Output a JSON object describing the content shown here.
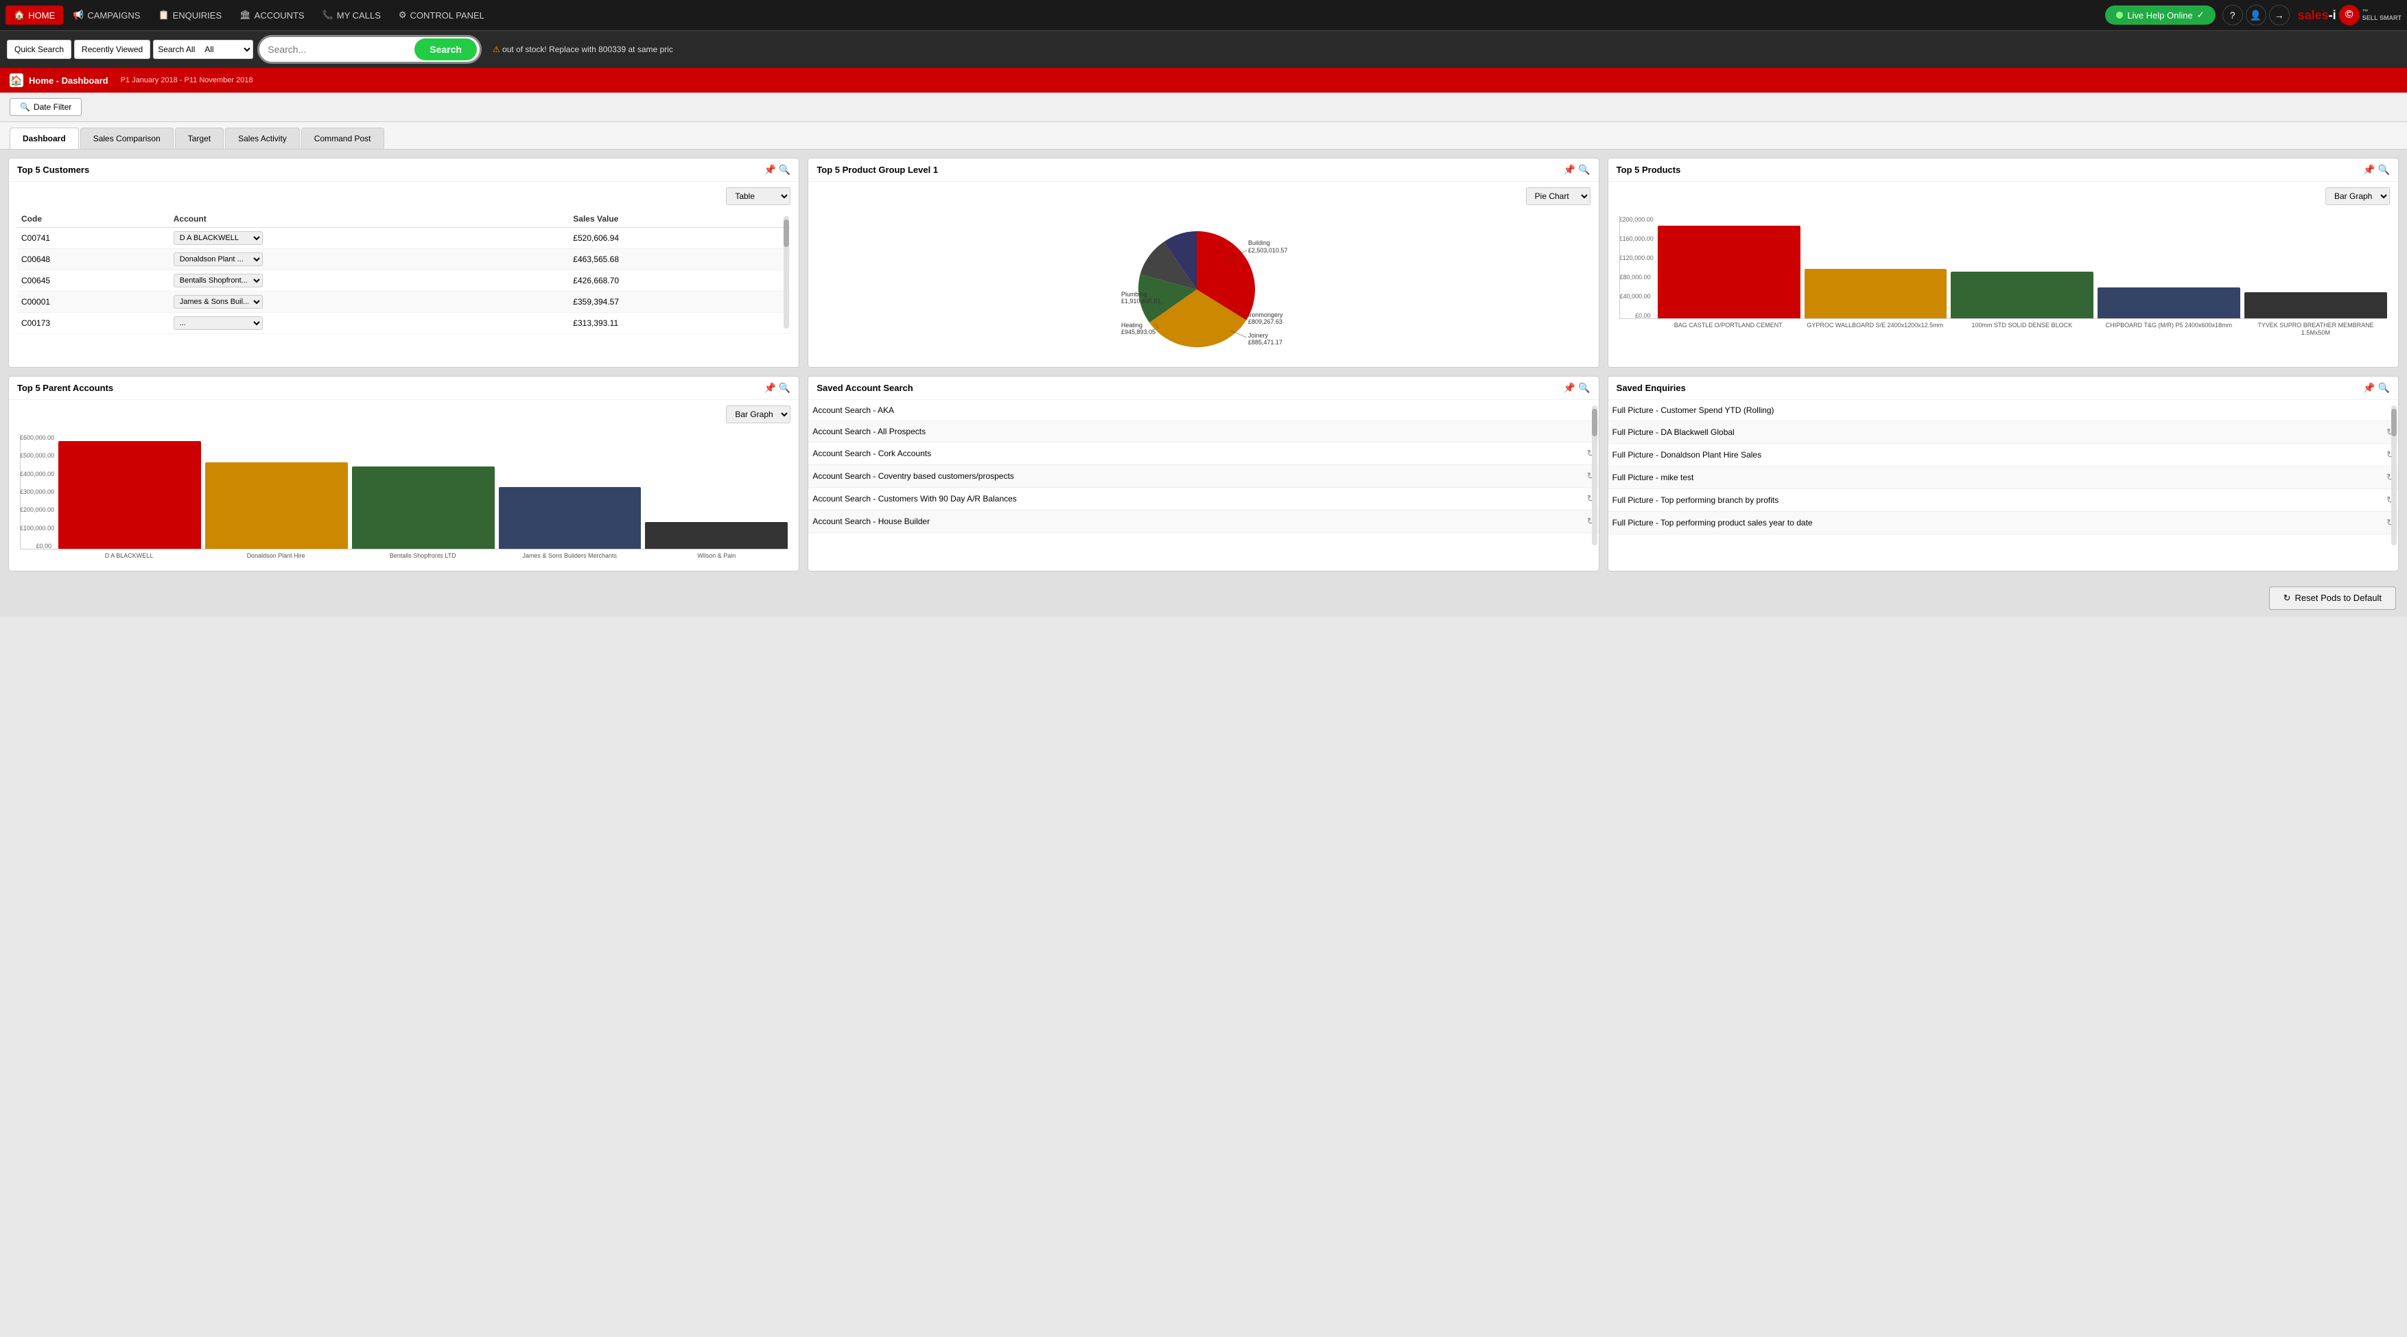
{
  "nav": {
    "items": [
      {
        "label": "HOME",
        "icon": "🏠",
        "active": true
      },
      {
        "label": "CAMPAIGNS",
        "icon": "📢",
        "active": false
      },
      {
        "label": "ENQUIRIES",
        "icon": "📋",
        "active": false
      },
      {
        "label": "ACCOUNTS",
        "icon": "🏛",
        "active": false
      },
      {
        "label": "MY CALLS",
        "icon": "📞",
        "active": false
      },
      {
        "label": "CONTROL PANEL",
        "icon": "⚙",
        "active": false
      }
    ],
    "live_help": "Live Help Online",
    "logo_main": "sales-i",
    "logo_sub": "SELL SMART"
  },
  "search_bar": {
    "quick_search": "Quick Search",
    "recently_viewed": "Recently Viewed",
    "search_all": "Search All",
    "search_all_option": "All",
    "placeholder": "Search...",
    "search_btn": "Search",
    "ticker_text": "out of stock! Replace with 800339 at same pric"
  },
  "breadcrumb": {
    "title": "Home - Dashboard",
    "date_range": "P1 January 2018 - P11 November 2018"
  },
  "filter": {
    "date_filter": "Date Filter"
  },
  "tabs": [
    {
      "label": "Dashboard",
      "active": true
    },
    {
      "label": "Sales Comparison",
      "active": false
    },
    {
      "label": "Target",
      "active": false
    },
    {
      "label": "Sales Activity",
      "active": false
    },
    {
      "label": "Command Post",
      "active": false
    }
  ],
  "pods": {
    "top5_customers": {
      "title": "Top 5 Customers",
      "view_options": [
        "Table",
        "Bar Graph",
        "Pie Chart"
      ],
      "selected_view": "Table",
      "columns": [
        "Code",
        "Account",
        "Sales Value"
      ],
      "rows": [
        {
          "code": "C00741",
          "account": "D A BLACKWELL",
          "value": "£520,606.94"
        },
        {
          "code": "C00648",
          "account": "Donaldson Plant ...",
          "value": "£463,565.68"
        },
        {
          "code": "C00645",
          "account": "Bentalls Shopfront...",
          "value": "£426,668.70"
        },
        {
          "code": "C00001",
          "account": "James & Sons Buil...",
          "value": "£359,394.57"
        },
        {
          "code": "C00173",
          "account": "...",
          "value": "£313,393.11"
        }
      ]
    },
    "top5_product_group": {
      "title": "Top 5 Product Group Level 1",
      "view_options": [
        "Pie Chart",
        "Bar Graph",
        "Table"
      ],
      "selected_view": "Pie Chart",
      "segments": [
        {
          "label": "Building",
          "value": "£2,503,010.57",
          "color": "#cc0000",
          "percent": 34
        },
        {
          "label": "Ironmongery",
          "value": "£809,267.63",
          "color": "#333366",
          "percent": 11
        },
        {
          "label": "Joinery",
          "value": "£885,471.17",
          "color": "#444444",
          "percent": 12
        },
        {
          "label": "Heating",
          "value": "£945,893.05",
          "color": "#336633",
          "percent": 13
        },
        {
          "label": "Plumbing",
          "value": "£1,910,695.51",
          "color": "#cc8800",
          "percent": 26
        }
      ]
    },
    "top5_products": {
      "title": "Top 5 Products",
      "view_options": [
        "Bar Graph",
        "Table",
        "Pie Chart"
      ],
      "selected_view": "Bar Graph",
      "bars": [
        {
          "label": "BAG CASTLE O/PORTLAND CEMENT",
          "value": 180000,
          "color": "#cc0000"
        },
        {
          "label": "GYPROC WALLBOARD S/E 2400x1200x12.5mm",
          "value": 95000,
          "color": "#cc8800"
        },
        {
          "label": "100mm STD SOLID DENSE BLOCK",
          "value": 90000,
          "color": "#336633"
        },
        {
          "label": "CHIPBOARD T&G (M/R) P5 2400x600x18mm",
          "value": 60000,
          "color": "#334466"
        },
        {
          "label": "TYVEK SUPRO BREATHER MEMBRANE 1.5Mx50M",
          "value": 50000,
          "color": "#333333"
        }
      ],
      "y_labels": [
        "£200,000.00",
        "£160,000.00",
        "£120,000.00",
        "£80,000.00",
        "£40,000.00",
        "£0.00"
      ]
    },
    "top5_parent_accounts": {
      "title": "Top 5 Parent Accounts",
      "view_options": [
        "Bar Graph",
        "Table",
        "Pie Chart"
      ],
      "selected_view": "Bar Graph",
      "bars": [
        {
          "label": "D A BLACKWELL",
          "value": 560000,
          "color": "#cc0000"
        },
        {
          "label": "Donaldson Plant Hire",
          "value": 450000,
          "color": "#cc8800"
        },
        {
          "label": "Bentalls Shopfronts LTD",
          "value": 430000,
          "color": "#336633"
        },
        {
          "label": "James & Sons Builders Merchants",
          "value": 320000,
          "color": "#334466"
        },
        {
          "label": "Wilson & Pain",
          "value": 140000,
          "color": "#333333"
        }
      ],
      "y_labels": [
        "£600,000.00",
        "£500,000.00",
        "£400,000.00",
        "£300,000.00",
        "£200,000.00",
        "£100,000.00",
        "£0.00"
      ]
    },
    "saved_account_search": {
      "title": "Saved Account Search",
      "items": [
        {
          "label": "Account Search - AKA",
          "has_icon": false
        },
        {
          "label": "Account Search - All Prospects",
          "has_icon": false
        },
        {
          "label": "Account Search - Cork Accounts",
          "has_icon": true
        },
        {
          "label": "Account Search - Coventry based customers/prospects",
          "has_icon": true
        },
        {
          "label": "Account Search - Customers With 90 Day A/R Balances",
          "has_icon": true
        },
        {
          "label": "Account Search - House Builder",
          "has_icon": true
        }
      ]
    },
    "saved_enquiries": {
      "title": "Saved Enquiries",
      "items": [
        {
          "label": "Full Picture - Customer Spend YTD (Rolling)",
          "has_icon": false
        },
        {
          "label": "Full Picture - DA Blackwell Global",
          "has_icon": true
        },
        {
          "label": "Full Picture - Donaldson Plant Hire Sales",
          "has_icon": true
        },
        {
          "label": "Full Picture - mike test",
          "has_icon": true
        },
        {
          "label": "Full Picture - Top performing branch by profits",
          "has_icon": true
        },
        {
          "label": "Full Picture - Top performing product sales year to date",
          "has_icon": true
        }
      ]
    }
  },
  "bottom": {
    "reset_btn": "Reset Pods to Default"
  }
}
